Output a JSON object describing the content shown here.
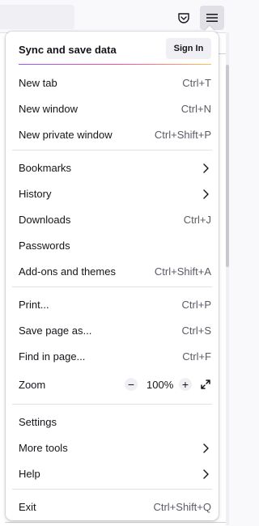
{
  "menu": {
    "sync": {
      "label": "Sync and save data",
      "sign_in": "Sign In"
    },
    "items": [
      {
        "label": "New tab",
        "shortcut": "Ctrl+T"
      },
      {
        "label": "New window",
        "shortcut": "Ctrl+N"
      },
      {
        "label": "New private window",
        "shortcut": "Ctrl+Shift+P"
      },
      {
        "label": "Bookmarks"
      },
      {
        "label": "History"
      },
      {
        "label": "Downloads",
        "shortcut": "Ctrl+J"
      },
      {
        "label": "Passwords"
      },
      {
        "label": "Add-ons and themes",
        "shortcut": "Ctrl+Shift+A"
      },
      {
        "label": "Print...",
        "shortcut": "Ctrl+P"
      },
      {
        "label": "Save page as...",
        "shortcut": "Ctrl+S"
      },
      {
        "label": "Find in page...",
        "shortcut": "Ctrl+F"
      },
      {
        "label": "Settings"
      },
      {
        "label": "More tools"
      },
      {
        "label": "Help"
      },
      {
        "label": "Exit",
        "shortcut": "Ctrl+Shift+Q"
      }
    ],
    "zoom": {
      "label": "Zoom",
      "minus": "−",
      "plus": "+",
      "value": "100%"
    }
  },
  "icons": [
    "pocket-icon",
    "hamburger-menu-icon",
    "chevron-right-icon",
    "fullscreen-icon"
  ],
  "colors": {
    "accent_gradient": [
      "#9059ff",
      "#ff4aa2",
      "#ffbd4f"
    ],
    "panel_bg": "#ffffff",
    "shortcut_text": "#5b5b66"
  }
}
